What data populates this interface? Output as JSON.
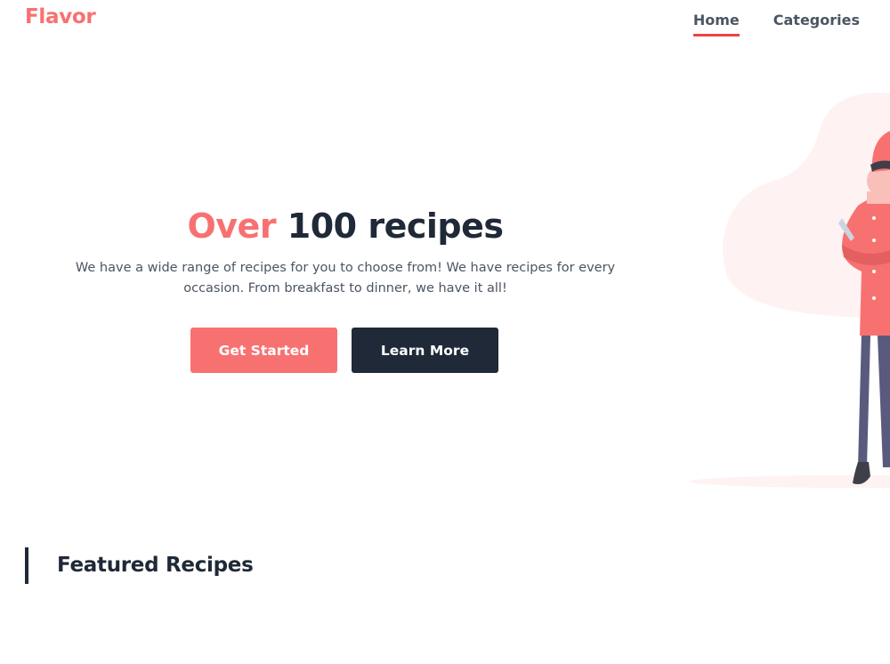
{
  "brand": {
    "name": "Flavor"
  },
  "nav": {
    "items": [
      {
        "label": "Home",
        "active": true
      },
      {
        "label": "Categories",
        "active": false
      }
    ]
  },
  "hero": {
    "title_accent": "Over",
    "title_rest": "100 recipes",
    "description": "We have a wide range of recipes for you to choose from! We have recipes for every occasion. From breakfast to dinner, we have it all!",
    "primary_button": "Get Started",
    "secondary_button": "Learn More"
  },
  "illustration": {
    "icon": "chef-illustration"
  },
  "featured": {
    "title": "Featured Recipes"
  },
  "colors": {
    "accent": "#f87171",
    "dark": "#1f2937",
    "text": "#4b5563",
    "nav_underline": "#ef4444",
    "blob": "#fef2f2"
  }
}
